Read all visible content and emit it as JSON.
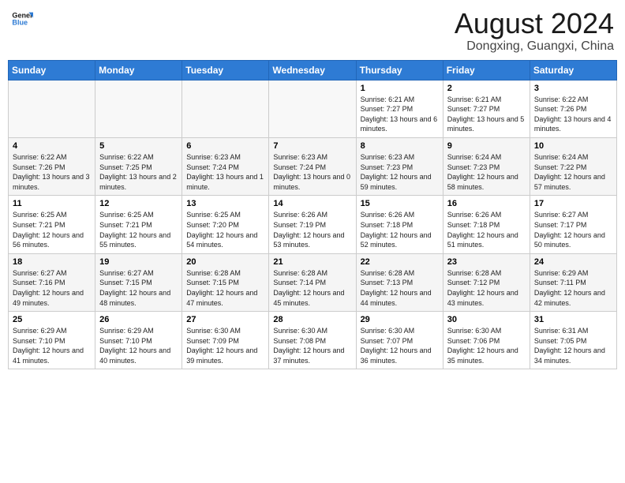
{
  "header": {
    "logo_line1": "General",
    "logo_line2": "Blue",
    "month": "August 2024",
    "location": "Dongxing, Guangxi, China"
  },
  "weekdays": [
    "Sunday",
    "Monday",
    "Tuesday",
    "Wednesday",
    "Thursday",
    "Friday",
    "Saturday"
  ],
  "weeks": [
    [
      {
        "day": "",
        "info": ""
      },
      {
        "day": "",
        "info": ""
      },
      {
        "day": "",
        "info": ""
      },
      {
        "day": "",
        "info": ""
      },
      {
        "day": "1",
        "info": "Sunrise: 6:21 AM\nSunset: 7:27 PM\nDaylight: 13 hours\nand 6 minutes."
      },
      {
        "day": "2",
        "info": "Sunrise: 6:21 AM\nSunset: 7:27 PM\nDaylight: 13 hours\nand 5 minutes."
      },
      {
        "day": "3",
        "info": "Sunrise: 6:22 AM\nSunset: 7:26 PM\nDaylight: 13 hours\nand 4 minutes."
      }
    ],
    [
      {
        "day": "4",
        "info": "Sunrise: 6:22 AM\nSunset: 7:26 PM\nDaylight: 13 hours\nand 3 minutes."
      },
      {
        "day": "5",
        "info": "Sunrise: 6:22 AM\nSunset: 7:25 PM\nDaylight: 13 hours\nand 2 minutes."
      },
      {
        "day": "6",
        "info": "Sunrise: 6:23 AM\nSunset: 7:24 PM\nDaylight: 13 hours\nand 1 minute."
      },
      {
        "day": "7",
        "info": "Sunrise: 6:23 AM\nSunset: 7:24 PM\nDaylight: 13 hours\nand 0 minutes."
      },
      {
        "day": "8",
        "info": "Sunrise: 6:23 AM\nSunset: 7:23 PM\nDaylight: 12 hours\nand 59 minutes."
      },
      {
        "day": "9",
        "info": "Sunrise: 6:24 AM\nSunset: 7:23 PM\nDaylight: 12 hours\nand 58 minutes."
      },
      {
        "day": "10",
        "info": "Sunrise: 6:24 AM\nSunset: 7:22 PM\nDaylight: 12 hours\nand 57 minutes."
      }
    ],
    [
      {
        "day": "11",
        "info": "Sunrise: 6:25 AM\nSunset: 7:21 PM\nDaylight: 12 hours\nand 56 minutes."
      },
      {
        "day": "12",
        "info": "Sunrise: 6:25 AM\nSunset: 7:21 PM\nDaylight: 12 hours\nand 55 minutes."
      },
      {
        "day": "13",
        "info": "Sunrise: 6:25 AM\nSunset: 7:20 PM\nDaylight: 12 hours\nand 54 minutes."
      },
      {
        "day": "14",
        "info": "Sunrise: 6:26 AM\nSunset: 7:19 PM\nDaylight: 12 hours\nand 53 minutes."
      },
      {
        "day": "15",
        "info": "Sunrise: 6:26 AM\nSunset: 7:18 PM\nDaylight: 12 hours\nand 52 minutes."
      },
      {
        "day": "16",
        "info": "Sunrise: 6:26 AM\nSunset: 7:18 PM\nDaylight: 12 hours\nand 51 minutes."
      },
      {
        "day": "17",
        "info": "Sunrise: 6:27 AM\nSunset: 7:17 PM\nDaylight: 12 hours\nand 50 minutes."
      }
    ],
    [
      {
        "day": "18",
        "info": "Sunrise: 6:27 AM\nSunset: 7:16 PM\nDaylight: 12 hours\nand 49 minutes."
      },
      {
        "day": "19",
        "info": "Sunrise: 6:27 AM\nSunset: 7:15 PM\nDaylight: 12 hours\nand 48 minutes."
      },
      {
        "day": "20",
        "info": "Sunrise: 6:28 AM\nSunset: 7:15 PM\nDaylight: 12 hours\nand 47 minutes."
      },
      {
        "day": "21",
        "info": "Sunrise: 6:28 AM\nSunset: 7:14 PM\nDaylight: 12 hours\nand 45 minutes."
      },
      {
        "day": "22",
        "info": "Sunrise: 6:28 AM\nSunset: 7:13 PM\nDaylight: 12 hours\nand 44 minutes."
      },
      {
        "day": "23",
        "info": "Sunrise: 6:28 AM\nSunset: 7:12 PM\nDaylight: 12 hours\nand 43 minutes."
      },
      {
        "day": "24",
        "info": "Sunrise: 6:29 AM\nSunset: 7:11 PM\nDaylight: 12 hours\nand 42 minutes."
      }
    ],
    [
      {
        "day": "25",
        "info": "Sunrise: 6:29 AM\nSunset: 7:10 PM\nDaylight: 12 hours\nand 41 minutes."
      },
      {
        "day": "26",
        "info": "Sunrise: 6:29 AM\nSunset: 7:10 PM\nDaylight: 12 hours\nand 40 minutes."
      },
      {
        "day": "27",
        "info": "Sunrise: 6:30 AM\nSunset: 7:09 PM\nDaylight: 12 hours\nand 39 minutes."
      },
      {
        "day": "28",
        "info": "Sunrise: 6:30 AM\nSunset: 7:08 PM\nDaylight: 12 hours\nand 37 minutes."
      },
      {
        "day": "29",
        "info": "Sunrise: 6:30 AM\nSunset: 7:07 PM\nDaylight: 12 hours\nand 36 minutes."
      },
      {
        "day": "30",
        "info": "Sunrise: 6:30 AM\nSunset: 7:06 PM\nDaylight: 12 hours\nand 35 minutes."
      },
      {
        "day": "31",
        "info": "Sunrise: 6:31 AM\nSunset: 7:05 PM\nDaylight: 12 hours\nand 34 minutes."
      }
    ]
  ]
}
